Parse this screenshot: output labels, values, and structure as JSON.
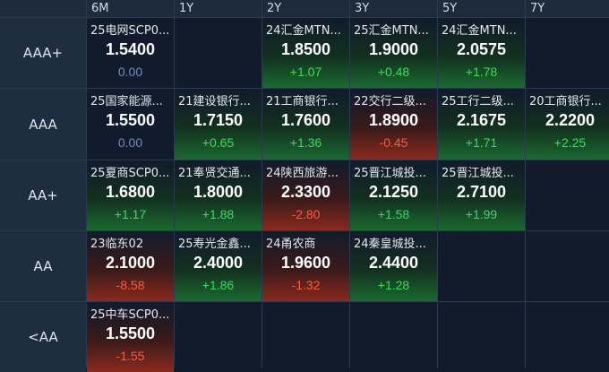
{
  "columns": [
    "6M",
    "1Y",
    "2Y",
    "3Y",
    "5Y",
    "7Y"
  ],
  "rows": [
    {
      "label": "AAA+",
      "cells": [
        {
          "name": "25电网SCP0...",
          "price": "1.5400",
          "change": "0.00",
          "trend": "flat"
        },
        null,
        {
          "name": "24汇金MTN...",
          "price": "1.8500",
          "change": "+1.07",
          "trend": "up"
        },
        {
          "name": "25汇金MTN...",
          "price": "1.9000",
          "change": "+0.48",
          "trend": "up"
        },
        {
          "name": "24汇金MTN...",
          "price": "2.0575",
          "change": "+1.78",
          "trend": "up"
        },
        null
      ]
    },
    {
      "label": "AAA",
      "cells": [
        {
          "name": "25国家能源...",
          "price": "1.5500",
          "change": "0.00",
          "trend": "flat"
        },
        {
          "name": "21建设银行...",
          "price": "1.7150",
          "change": "+0.65",
          "trend": "up"
        },
        {
          "name": "21工商银行...",
          "price": "1.7600",
          "change": "+1.36",
          "trend": "up"
        },
        {
          "name": "22交行二级...",
          "price": "1.8900",
          "change": "-0.45",
          "trend": "down"
        },
        {
          "name": "25工行二级...",
          "price": "2.1675",
          "change": "+1.71",
          "trend": "up"
        },
        {
          "name": "20工商银行...",
          "price": "2.2200",
          "change": "+2.25",
          "trend": "up"
        }
      ]
    },
    {
      "label": "AA+",
      "cells": [
        {
          "name": "25夏商SCP0...",
          "price": "1.6800",
          "change": "+1.17",
          "trend": "up"
        },
        {
          "name": "21奉贤交通...",
          "price": "1.8000",
          "change": "+1.88",
          "trend": "up"
        },
        {
          "name": "24陕西旅游...",
          "price": "2.3300",
          "change": "-2.80",
          "trend": "down"
        },
        {
          "name": "25晋江城投...",
          "price": "2.1250",
          "change": "+1.58",
          "trend": "up"
        },
        {
          "name": "25晋江城投...",
          "price": "2.7100",
          "change": "+1.99",
          "trend": "up"
        },
        null
      ]
    },
    {
      "label": "AA",
      "cells": [
        {
          "name": "23临东02",
          "price": "2.1000",
          "change": "-8.58",
          "trend": "down"
        },
        {
          "name": "25寿光金鑫...",
          "price": "2.4000",
          "change": "+1.86",
          "trend": "up"
        },
        {
          "name": "24甬农商",
          "price": "1.9600",
          "change": "-1.32",
          "trend": "down"
        },
        {
          "name": "24秦皇城投...",
          "price": "2.4400",
          "change": "+1.28",
          "trend": "up"
        },
        null,
        null
      ]
    },
    {
      "label": "<AA",
      "cells": [
        {
          "name": "25中车SCP0...",
          "price": "1.5500",
          "change": "-1.55",
          "trend": "down"
        },
        null,
        null,
        null,
        null,
        null
      ]
    }
  ]
}
